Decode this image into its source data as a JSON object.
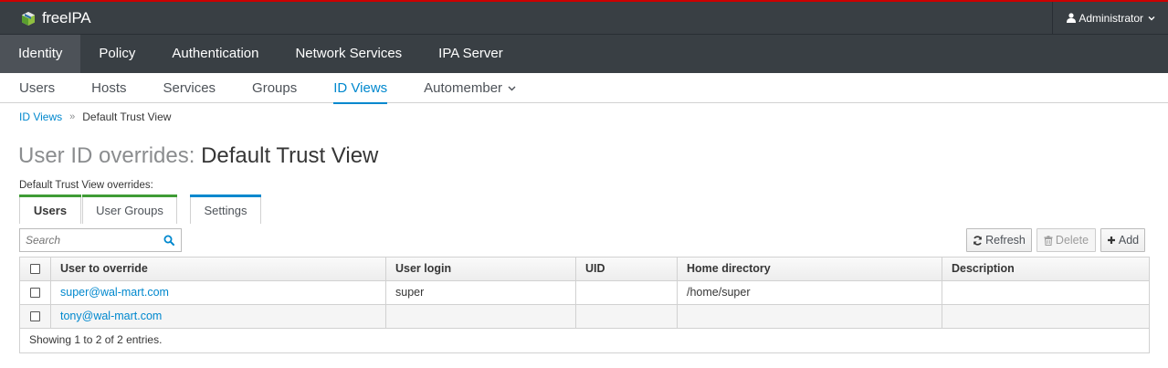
{
  "header": {
    "brand": "freeIPA",
    "user": "Administrator",
    "icons": [
      "freeipa-logo-icon",
      "user-icon",
      "caret-down-icon"
    ]
  },
  "primary_nav": [
    {
      "label": "Identity",
      "active": true
    },
    {
      "label": "Policy"
    },
    {
      "label": "Authentication"
    },
    {
      "label": "Network Services"
    },
    {
      "label": "IPA Server"
    }
  ],
  "secondary_nav": [
    {
      "label": "Users"
    },
    {
      "label": "Hosts"
    },
    {
      "label": "Services"
    },
    {
      "label": "Groups"
    },
    {
      "label": "ID Views",
      "active": true
    },
    {
      "label": "Automember"
    }
  ],
  "breadcrumb": {
    "parent": "ID Views",
    "separator": "»",
    "current": "Default Trust View"
  },
  "page": {
    "title_prefix": "User ID overrides:",
    "title_name": "Default Trust View",
    "overrides_label": "Default Trust View overrides:"
  },
  "facet_tabs": [
    {
      "label": "Users",
      "active": true
    },
    {
      "label": "User Groups"
    },
    {
      "label": "Settings"
    }
  ],
  "search": {
    "placeholder": "Search"
  },
  "actions": {
    "refresh": "Refresh",
    "delete": "Delete",
    "add": "Add"
  },
  "table": {
    "columns": [
      "User to override",
      "User login",
      "UID",
      "Home directory",
      "Description"
    ],
    "rows": [
      {
        "user": "super@wal-mart.com",
        "login": "super",
        "uid": "",
        "home": "/home/super",
        "description": ""
      },
      {
        "user": "tony@wal-mart.com",
        "login": "",
        "uid": "",
        "home": "",
        "description": ""
      }
    ],
    "footer": "Showing 1 to 2 of 2 entries."
  },
  "colors": {
    "accent": "#0088ce",
    "header_bg": "#393f44",
    "active_nav_bg": "#4d5258",
    "tab_green": "#3f9c35",
    "tab_blue": "#0088ce"
  }
}
